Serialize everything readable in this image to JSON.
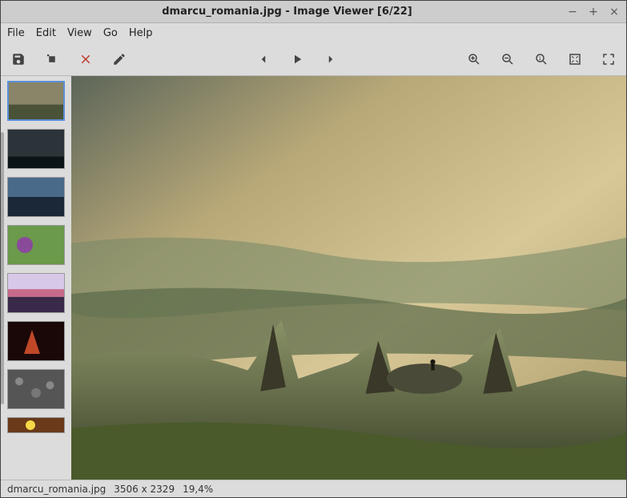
{
  "titlebar": {
    "title": "dmarcu_romania.jpg - Image Viewer [6/22]"
  },
  "menu": {
    "file": "File",
    "edit": "Edit",
    "view": "View",
    "go": "Go",
    "help": "Help"
  },
  "status": {
    "filename": "dmarcu_romania.jpg",
    "dimensions": "3506 x 2329",
    "zoom": "19,4%"
  },
  "icons": {
    "save": "save-icon",
    "rotate": "rotate-icon",
    "delete": "delete-icon",
    "edit": "edit-icon",
    "prev": "prev-icon",
    "play": "play-icon",
    "next": "next-icon",
    "zoomin": "zoom-in-icon",
    "zoomout": "zoom-out-icon",
    "zoomorig": "zoom-original-icon",
    "zoomfit": "zoom-fit-icon",
    "fullscreen": "fullscreen-icon"
  }
}
